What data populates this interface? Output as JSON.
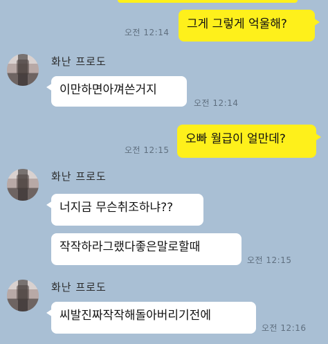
{
  "colors": {
    "background": "#a9bfd4",
    "outgoing_bubble": "#fef01b",
    "incoming_bubble": "#ffffff"
  },
  "messages": [
    {
      "direction": "outgoing",
      "text": "그게 그렇게 억울해?",
      "time": "오전 12:14"
    },
    {
      "direction": "incoming",
      "sender": "화난 프로도",
      "text": "이만하면아껴쓴거지",
      "time": "오전 12:14"
    },
    {
      "direction": "outgoing",
      "text": "오빠 월급이 얼만데?",
      "time": "오전 12:15"
    },
    {
      "direction": "incoming",
      "sender": "화난 프로도",
      "text": "너지금 무슨취조하냐??",
      "time": ""
    },
    {
      "direction": "incoming",
      "sender": "",
      "text": "작작하라그랬다좋은말로할때",
      "time": "오전 12:15"
    },
    {
      "direction": "incoming",
      "sender": "화난 프로도",
      "text": "씨발진짜작작해돌아버리기전에",
      "time": "오전 12:16"
    }
  ]
}
